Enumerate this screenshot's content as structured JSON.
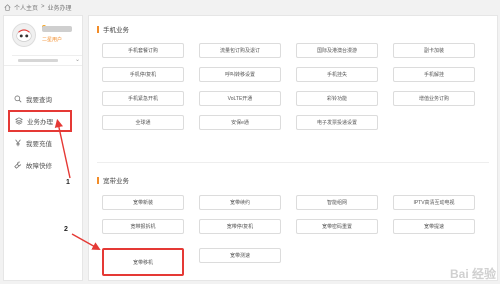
{
  "breadcrumb": {
    "home_icon": "home-icon",
    "root": "个人主页",
    "sep": ">",
    "current": "业务办理"
  },
  "profile": {
    "level": "二星用户"
  },
  "menu": [
    {
      "label": "我要查询",
      "icon": "search-icon"
    },
    {
      "label": "业务办理",
      "icon": "layers-icon"
    },
    {
      "label": "我要充值",
      "icon": "yuan-icon"
    },
    {
      "label": "故障快修",
      "icon": "wrench-icon"
    }
  ],
  "mobile_section": {
    "title": "手机业务",
    "items": [
      "手机套餐订购",
      "流量包订购及退订",
      "国际及港澳台漫游",
      "副卡加装",
      "手机停/复机",
      "呼叫转移设置",
      "手机挂失",
      "手机解挂",
      "手机紧急开机",
      "VoLTE开通",
      "彩铃功能",
      "增值业务订购",
      "全球通",
      "安保e通",
      "电子发票投递设置"
    ]
  },
  "broadband_section": {
    "title": "宽带业务",
    "items": [
      "宽带新装",
      "宽带续约",
      "智能组网",
      "IPTV高清互动电视",
      "宽带报拆机",
      "宽带停/复机",
      "宽带密码重置",
      "宽带提速",
      "宽带移机",
      "宽带测速"
    ]
  },
  "annotations": {
    "label_1": "1",
    "label_2": "2"
  },
  "colors": {
    "accent": "#f28c28",
    "highlight": "#e53935"
  }
}
